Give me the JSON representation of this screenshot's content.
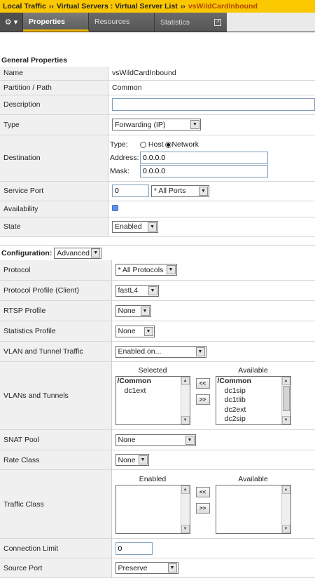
{
  "breadcrumb": {
    "part1": "Local Traffic",
    "sep": "››",
    "part2": "Virtual Servers : Virtual Server List",
    "part3": "vsWildCardInbound"
  },
  "tabs": {
    "gear_caret": "▾",
    "properties": "Properties",
    "resources": "Resources",
    "statistics": "Statistics"
  },
  "general": {
    "title": "General Properties",
    "name_label": "Name",
    "name_value": "vsWildCardInbound",
    "partition_label": "Partition / Path",
    "partition_value": "Common",
    "description_label": "Description",
    "description_value": "",
    "type_label": "Type",
    "type_value": "Forwarding (IP)",
    "destination_label": "Destination",
    "dest_type_label": "Type:",
    "dest_host": "Host",
    "dest_network": "Network",
    "dest_address_label": "Address:",
    "dest_address_value": "0.0.0.0",
    "dest_mask_label": "Mask:",
    "dest_mask_value": "0.0.0.0",
    "service_port_label": "Service Port",
    "service_port_value": "0",
    "service_port_select": "* All Ports",
    "availability_label": "Availability",
    "state_label": "State",
    "state_value": "Enabled"
  },
  "config": {
    "title": "Configuration:",
    "mode": "Advanced",
    "protocol_label": "Protocol",
    "protocol_value": "* All Protocols",
    "protocol_profile_label": "Protocol Profile (Client)",
    "protocol_profile_value": "fastL4",
    "rtsp_label": "RTSP Profile",
    "rtsp_value": "None",
    "stats_label": "Statistics Profile",
    "stats_value": "None",
    "vlan_traffic_label": "VLAN and Tunnel Traffic",
    "vlan_traffic_value": "Enabled on...",
    "vlans_label": "VLANs and Tunnels",
    "selected_label": "Selected",
    "available_label": "Available",
    "selected_items": [
      "/Common",
      "dc1ext"
    ],
    "available_items": [
      "/Common",
      "dc1sip",
      "dc1tlib",
      "dc2ext",
      "dc2sip"
    ],
    "move_left": "<<",
    "move_right": ">>",
    "snat_label": "SNAT Pool",
    "snat_value": "None",
    "rate_label": "Rate Class",
    "rate_value": "None",
    "traffic_label": "Traffic Class",
    "enabled_label": "Enabled",
    "traffic_available_label": "Available",
    "conn_limit_label": "Connection Limit",
    "conn_limit_value": "0",
    "source_port_label": "Source Port",
    "source_port_value": "Preserve"
  }
}
